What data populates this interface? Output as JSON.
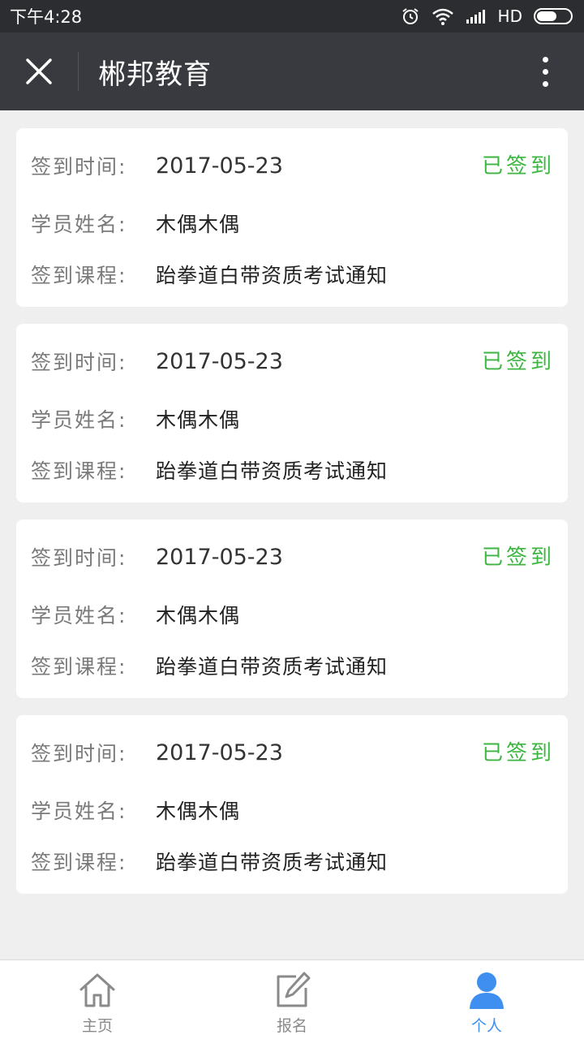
{
  "status_bar": {
    "time": "下午4:28",
    "network": "HD",
    "icons": [
      "alarm-icon",
      "wifi-icon",
      "signal-icon",
      "battery-icon"
    ],
    "battery_level": 0.6
  },
  "title_bar": {
    "title": "郴邦教育",
    "close_icon": "close-icon",
    "more_icon": "more-vertical-icon"
  },
  "labels": {
    "time": "签到时间:",
    "name": "学员姓名:",
    "course": "签到课程:"
  },
  "records": [
    {
      "date": "2017-05-23",
      "name": "木偶木偶",
      "course": "跆拳道白带资质考试通知",
      "status": "已签到"
    },
    {
      "date": "2017-05-23",
      "name": "木偶木偶",
      "course": "跆拳道白带资质考试通知",
      "status": "已签到"
    },
    {
      "date": "2017-05-23",
      "name": "木偶木偶",
      "course": "跆拳道白带资质考试通知",
      "status": "已签到"
    },
    {
      "date": "2017-05-23",
      "name": "木偶木偶",
      "course": "跆拳道白带资质考试通知",
      "status": "已签到"
    }
  ],
  "colors": {
    "status_green": "#3db641",
    "tab_active": "#3e8ff0",
    "title_bar_bg": "#393a3f"
  },
  "tab_bar": {
    "tabs": [
      {
        "label": "主页",
        "icon": "home-icon",
        "active": false
      },
      {
        "label": "报名",
        "icon": "edit-icon",
        "active": false
      },
      {
        "label": "个人",
        "icon": "user-icon",
        "active": true
      }
    ]
  }
}
